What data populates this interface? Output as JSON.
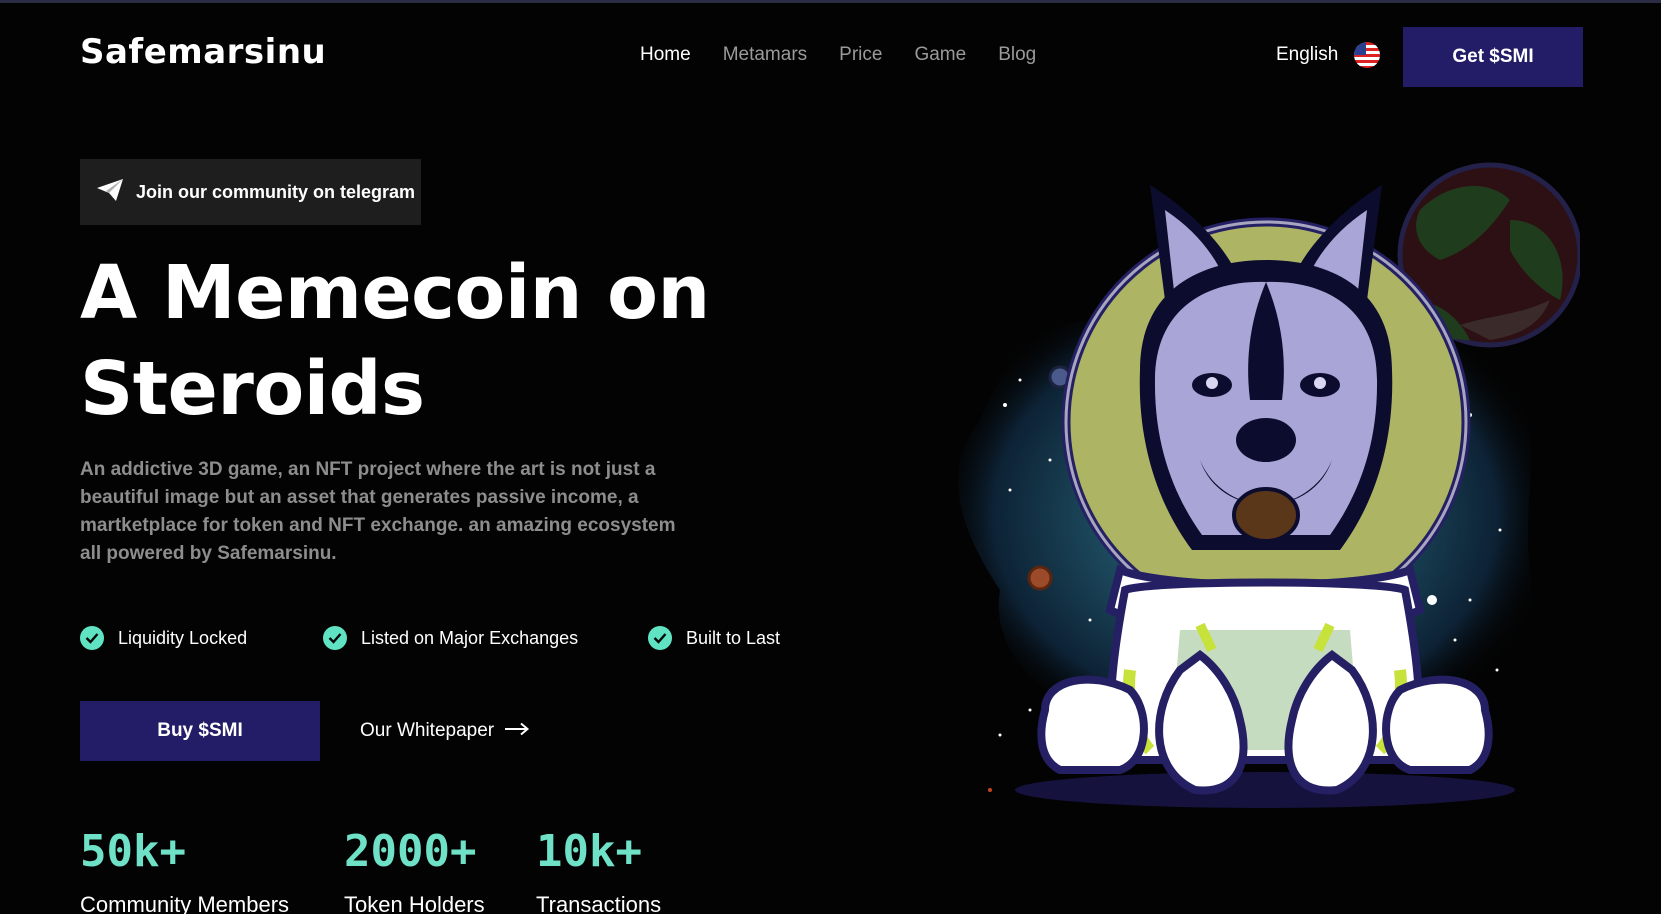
{
  "brand": {
    "name": "Safemarsinu"
  },
  "nav": {
    "items": [
      {
        "label": "Home"
      },
      {
        "label": "Metamars"
      },
      {
        "label": "Price"
      },
      {
        "label": "Game"
      },
      {
        "label": "Blog"
      }
    ],
    "active": "Home"
  },
  "header": {
    "language": "English",
    "flag_icon": "us-flag-icon",
    "cta_label": "Get $SMI"
  },
  "hero": {
    "telegram_label": "Join our community on telegram",
    "title_line1": "A Memecoin on",
    "title_line2": "Steroids",
    "description": "An addictive 3D game, an NFT project where the art is not just a beautiful image but an asset that generates passive income, a martketplace for token and NFT exchange. an amazing ecosystem all powered by Safemarsinu.",
    "features": [
      {
        "label": "Liquidity Locked"
      },
      {
        "label": "Listed on Major Exchanges"
      },
      {
        "label": "Built to Last"
      }
    ],
    "buy_label": "Buy $SMI",
    "whitepaper_label": "Our Whitepaper"
  },
  "stats": [
    {
      "value": "50k+",
      "label": "Community Members"
    },
    {
      "value": "2000+",
      "label": "Token Holders"
    },
    {
      "value": "10k+",
      "label": "Transactions"
    }
  ],
  "colors": {
    "background": "#030303",
    "primary_button": "#221d66",
    "accent": "#5fe3c2",
    "muted_text": "#8d8d8d"
  }
}
